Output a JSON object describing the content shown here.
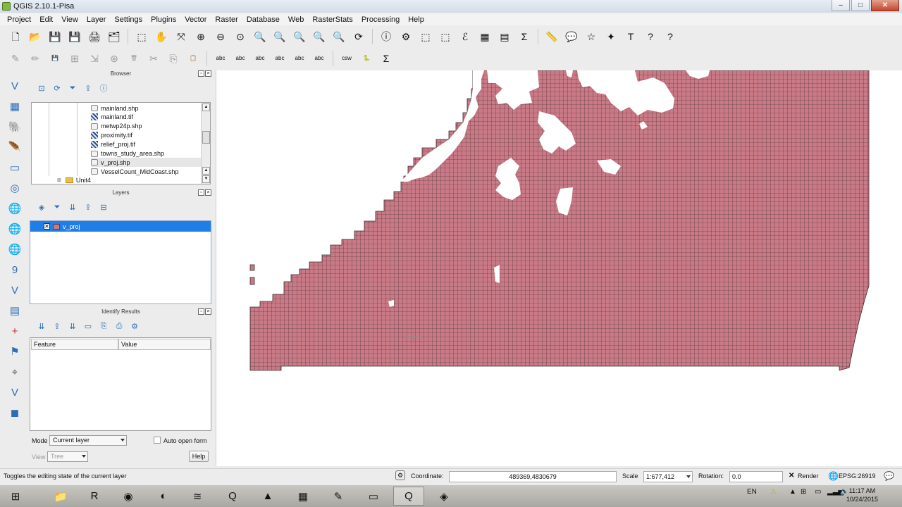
{
  "window": {
    "title": "QGIS 2.10.1-Pisa",
    "min": "–",
    "max": "□",
    "close": "✕"
  },
  "menu": [
    "Project",
    "Edit",
    "View",
    "Layer",
    "Settings",
    "Plugins",
    "Vector",
    "Raster",
    "Database",
    "Web",
    "RasterStats",
    "Processing",
    "Help"
  ],
  "toolbar_row1": [
    "new-project",
    "open-project",
    "save-project",
    "save-as",
    "print-composer",
    "composer-manager",
    "select-map",
    "pan",
    "pan-to-selection",
    "zoom-in",
    "zoom-out",
    "zoom-actual",
    "zoom-full",
    "zoom-layer",
    "zoom-selection",
    "zoom-last",
    "zoom-next",
    "refresh",
    "identify",
    "hand-action",
    "select-features",
    "deselect",
    "field-calculator",
    "attribute-table",
    "statistics",
    "sum",
    "measure",
    "map-tip",
    "bookmark",
    "new-bookmark",
    "text-annotation",
    "help",
    "whats-this"
  ],
  "toolbar_row1_glyphs": [
    "🗋",
    "📂",
    "💾",
    "💾",
    "🖨",
    "🗂",
    "⬚",
    "✋",
    "⤧",
    "⊕",
    "⊖",
    "⊙",
    "🔍",
    "🔍",
    "🔍",
    "🔍",
    "🔍",
    "⟳",
    "ⓘ",
    "⚙",
    "⬚",
    "⬚",
    "ℰ",
    "▦",
    "▤",
    "Σ",
    "📏",
    "💬",
    "☆",
    "✦",
    "T",
    "?",
    "?"
  ],
  "toolbar_row2": [
    "toggle-edit",
    "pencil",
    "save-edits",
    "add-feature",
    "move-feature",
    "node-tool",
    "delete",
    "cut",
    "copy",
    "paste",
    "label-abc",
    "label-pin",
    "label-show",
    "label-move",
    "label-rotate",
    "label-change",
    "csw",
    "python",
    "processing"
  ],
  "toolbar_row2_labels": [
    "✎",
    "✏",
    "💾",
    "⊞",
    "⇲",
    "⊛",
    "🗑",
    "✂",
    "⎘",
    "📋",
    "abc",
    "abc",
    "abc",
    "abc",
    "abc",
    "abc",
    "csw",
    "🐍",
    "Σ"
  ],
  "left_tools": [
    "add-vector-layer",
    "add-raster-layer",
    "add-postgis-layer",
    "add-spatialite-layer",
    "add-mssql-layer",
    "add-oracle-layer",
    "add-wms-layer",
    "add-wcs-layer",
    "add-wfs-layer",
    "add-delimited-text",
    "new-shapefile",
    "new-spatialite",
    "add-gpx",
    "gps-tools",
    "coordinate-capture",
    "georeferencer",
    "add-vector-layer-2"
  ],
  "left_tool_glyphs": [
    "V",
    "▦",
    "🐘",
    "🪶",
    "▭",
    "◎",
    "🌐",
    "🌐",
    "🌐",
    "9",
    "V",
    "▤",
    "+",
    "⚑",
    "⌖",
    "V",
    "◼"
  ],
  "browser": {
    "title": "Browser",
    "tools": [
      "add-selected",
      "refresh",
      "filter",
      "collapse",
      "properties"
    ],
    "items": [
      "mainland.shp",
      "mainland.tif",
      "metwp24p.shp",
      "proximity.tif",
      "relief_proj.tif",
      "towns_study_area.shp",
      "v_proj.shp",
      "VesselCount_MidCoast.shp"
    ],
    "item_types": [
      "vector",
      "raster",
      "vector",
      "raster",
      "raster",
      "vector",
      "vector",
      "vector"
    ],
    "folder": "Unit4"
  },
  "layers": {
    "title": "Layers",
    "tools": [
      "manage-visibility",
      "filter",
      "expand",
      "collapse",
      "remove"
    ],
    "items": [
      {
        "name": "v_proj",
        "checked": "✕",
        "color": "#c97a86"
      }
    ]
  },
  "identify": {
    "title": "Identify Results",
    "tools": [
      "expand",
      "collapse",
      "expand-new",
      "clear",
      "copy",
      "print",
      "configure"
    ],
    "columns": [
      "Feature",
      "Value"
    ],
    "mode_label": "Mode",
    "mode_value": "Current layer",
    "auto_open_label": "Auto open form",
    "view_label": "View",
    "view_value": "Tree",
    "help_label": "Help"
  },
  "status": {
    "message": "Toggles the editing state of the current layer",
    "coordinate_label": "Coordinate:",
    "coordinate_value": "489369,4830679",
    "scale_label": "Scale",
    "scale_value": "1:677,412",
    "rotation_label": "Rotation:",
    "rotation_value": "0.0",
    "render_label": "Render",
    "render_check": "✕",
    "crs": "EPSG:26919"
  },
  "map": {
    "fill": "#c97a86",
    "grid": "#3d2a2e",
    "background": "#ffffff"
  },
  "taskbar": {
    "apps": [
      "start",
      "file-explorer",
      "r",
      "chrome",
      "inkscape",
      "app-blue",
      "qgis-browser",
      "app-dark",
      "calculator",
      "paint",
      "app-window",
      "qgis-desktop",
      "qgis-2"
    ],
    "app_glyphs": [
      "⊞",
      "📁",
      "R",
      "◉",
      "◐",
      "≋",
      "Q",
      "▲",
      "▦",
      "✎",
      "▭",
      "Q",
      "◈"
    ],
    "lang": "EN",
    "time": "11:17 AM",
    "date": "10/24/2015"
  }
}
